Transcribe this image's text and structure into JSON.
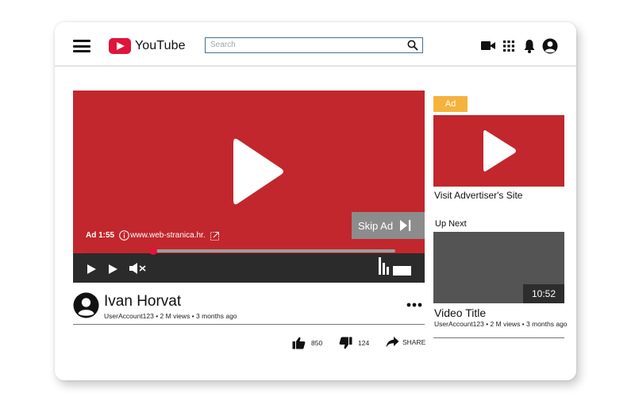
{
  "header": {
    "logo_text": "YouTube",
    "search_placeholder": "Search",
    "icons": [
      "menu-icon",
      "search-icon",
      "video-camera-icon",
      "apps-grid-icon",
      "bell-icon",
      "account-icon"
    ]
  },
  "player": {
    "ad_time": "Ad 1:55",
    "ad_url": "www.web-stranica.hr.",
    "skip_label": "Skip Ad",
    "progress_fraction": 0.23
  },
  "video": {
    "channel_name": "Ivan Horvat",
    "meta": "UserAccount123 • 2 M views • 3 months ago",
    "likes": "850",
    "dislikes": "124",
    "share_label": "SHARE"
  },
  "sidebar": {
    "ad_badge": "Ad",
    "ad_link": "Visit Advertiser's Site",
    "up_next_label": "Up Next",
    "next_video": {
      "duration": "10:52",
      "title": "Video Title",
      "meta": "UserAccount123 • 2 M views • 3 months ago"
    }
  },
  "colors": {
    "brand_red": "#c1272d",
    "ad_badge": "#f5b23d",
    "control_bar": "#2b2b2b",
    "progress_knob": "#e0133b"
  }
}
